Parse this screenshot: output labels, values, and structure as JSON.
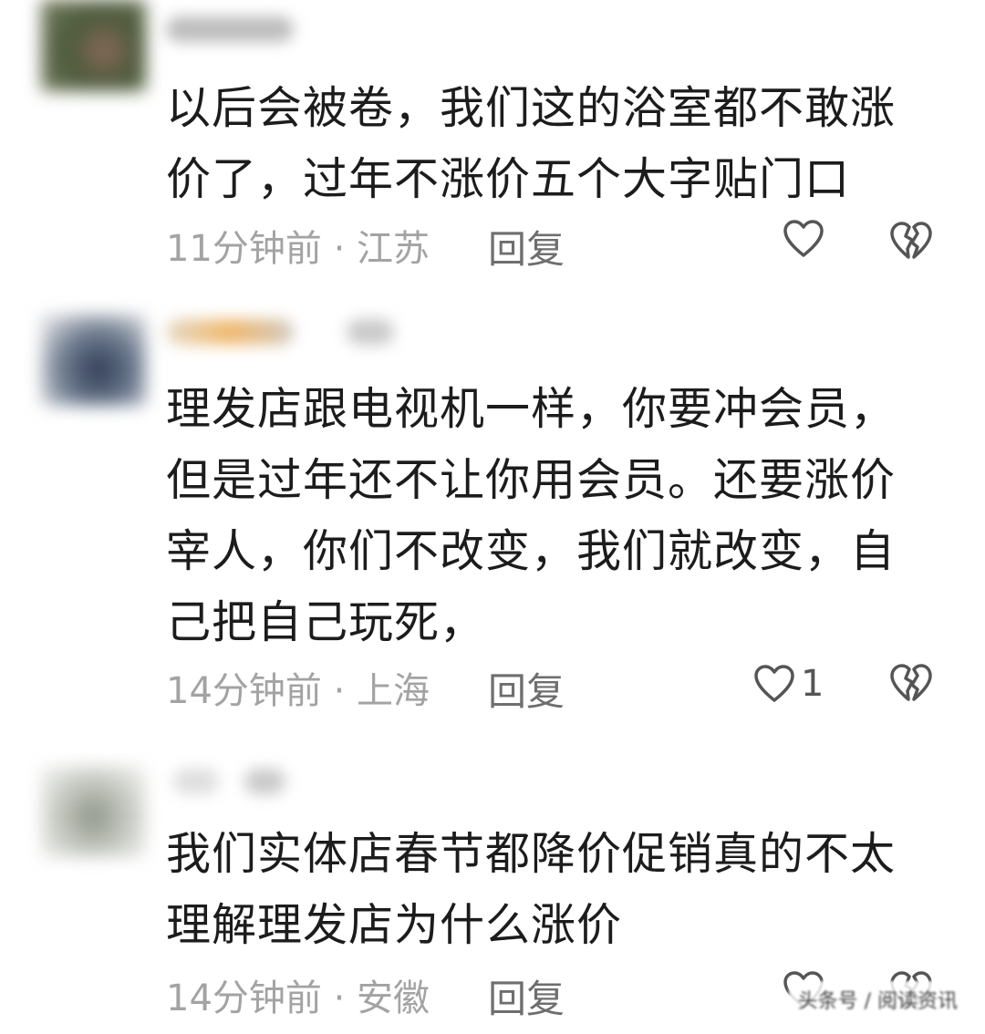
{
  "comments": [
    {
      "text": "以后会被卷，我们这的浴室都不敢涨价了，过年不涨价五个大字贴门口",
      "time_location": "11分钟前 · 江苏",
      "reply_label": "回复",
      "like_count": "",
      "avatar_color": "#4b5a3c"
    },
    {
      "text": "理发店跟电视机一样，你要冲会员，但是过年还不让你用会员。还要涨价宰人，你们不改变，我们就改变，自己把自己玩死，",
      "time_location": "14分钟前 · 上海",
      "reply_label": "回复",
      "like_count": "1",
      "avatar_color": "#6c7a8e"
    },
    {
      "text": "我们实体店春节都降价促销真的不太理解理发店为什么涨价",
      "time_location": "14分钟前 · 安徽",
      "reply_label": "回复",
      "like_count": "",
      "avatar_color": "#b7bcb4"
    }
  ],
  "icons": {
    "like": "heart-outline-icon",
    "dislike": "broken-heart-icon"
  },
  "colors": {
    "text": "#1c1c1c",
    "meta": "#a3a3a3",
    "icon": "#555555"
  },
  "watermark": "头条号 / 阅读资讯"
}
